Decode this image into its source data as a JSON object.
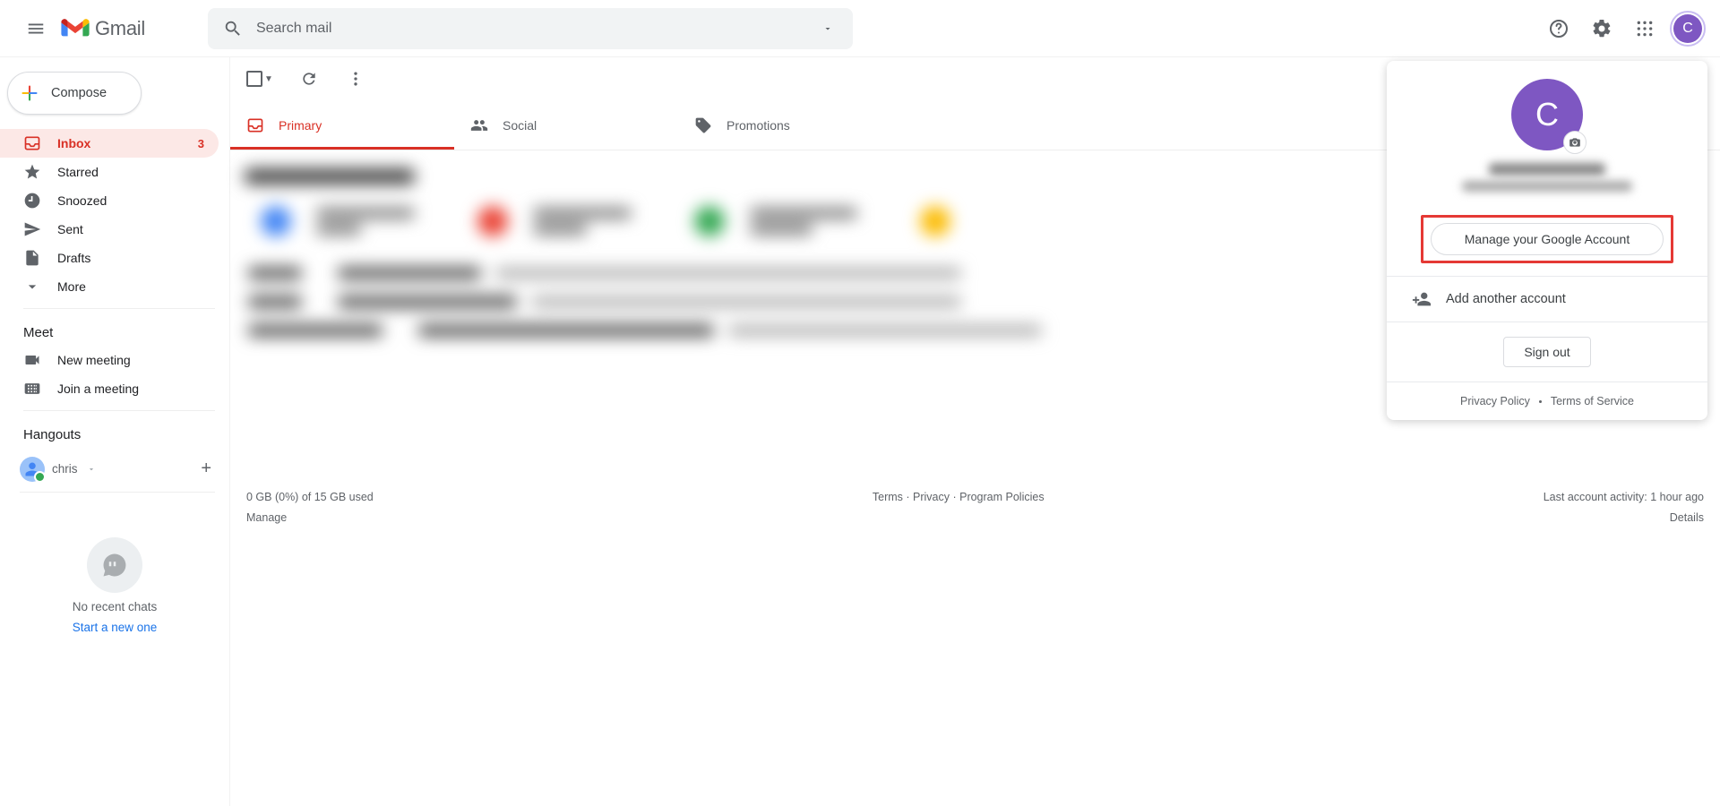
{
  "header": {
    "brand": "Gmail",
    "search_placeholder": "Search mail",
    "avatar_initial": "C"
  },
  "sidebar": {
    "compose": "Compose",
    "items": [
      {
        "label": "Inbox",
        "count": "3"
      },
      {
        "label": "Starred"
      },
      {
        "label": "Snoozed"
      },
      {
        "label": "Sent"
      },
      {
        "label": "Drafts"
      },
      {
        "label": "More"
      }
    ],
    "meet": {
      "title": "Meet",
      "new_meeting": "New meeting",
      "join_meeting": "Join a meeting"
    },
    "hangouts": {
      "title": "Hangouts",
      "user": "chris",
      "no_chats": "No recent chats",
      "start_new": "Start a new one"
    }
  },
  "tabs": {
    "primary": "Primary",
    "social": "Social",
    "promotions": "Promotions"
  },
  "footer": {
    "storage": "0 GB (0%) of 15 GB used",
    "manage": "Manage",
    "terms": "Terms",
    "privacy": "Privacy",
    "policies": "Program Policies",
    "activity": "Last account activity: 1 hour ago",
    "details": "Details"
  },
  "account_popup": {
    "avatar_initial": "C",
    "manage": "Manage your Google Account",
    "add_account": "Add another account",
    "sign_out": "Sign out",
    "privacy_policy": "Privacy Policy",
    "tos": "Terms of Service"
  }
}
